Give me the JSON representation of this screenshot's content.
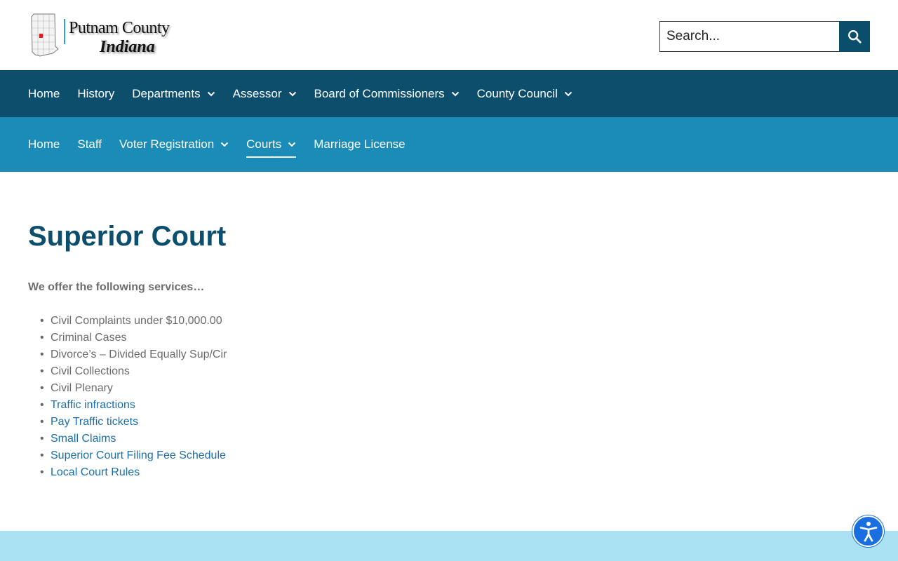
{
  "header": {
    "logo": {
      "name": "Putnam County",
      "state": "Indiana"
    },
    "search": {
      "placeholder": "Search...",
      "button_icon": "search-icon"
    }
  },
  "primary_nav": [
    {
      "label": "Home",
      "has_dropdown": false
    },
    {
      "label": "History",
      "has_dropdown": false
    },
    {
      "label": "Departments",
      "has_dropdown": true
    },
    {
      "label": "Assessor",
      "has_dropdown": true
    },
    {
      "label": "Board of Commissioners",
      "has_dropdown": true
    },
    {
      "label": "County Council",
      "has_dropdown": true
    }
  ],
  "secondary_nav": [
    {
      "label": "Home",
      "has_dropdown": false,
      "active": false
    },
    {
      "label": "Staff",
      "has_dropdown": false,
      "active": false
    },
    {
      "label": "Voter Registration",
      "has_dropdown": true,
      "active": false
    },
    {
      "label": "Courts",
      "has_dropdown": true,
      "active": true
    },
    {
      "label": "Marriage License",
      "has_dropdown": false,
      "active": false
    }
  ],
  "main": {
    "title": "Superior Court",
    "intro": "We offer the following services…",
    "services": [
      {
        "text": "Civil Complaints under $10,000.00",
        "link": false
      },
      {
        "text": "Criminal Cases",
        "link": false
      },
      {
        "text": "Divorce’s – Divided Equally Sup/Cir",
        "link": false
      },
      {
        "text": "Civil Collections",
        "link": false
      },
      {
        "text": "Civil Plenary",
        "link": false
      },
      {
        "text": "Traffic infractions",
        "link": true
      },
      {
        "text": "Pay Traffic tickets",
        "link": true
      },
      {
        "text": "Small Claims",
        "link": true
      },
      {
        "text": "Superior Court Filing Fee Schedule",
        "link": true
      },
      {
        "text": "Local Court Rules",
        "link": true
      }
    ]
  },
  "colors": {
    "primary_nav_bg": "#0c4e6b",
    "secondary_nav_bg": "#1b8bb8",
    "title": "#0c4e6b",
    "link": "#1a6fa8",
    "footer_band": "#abe2f3",
    "accessibility_button": "#1a6fe0"
  },
  "accessibility": {
    "icon": "accessibility-icon"
  }
}
